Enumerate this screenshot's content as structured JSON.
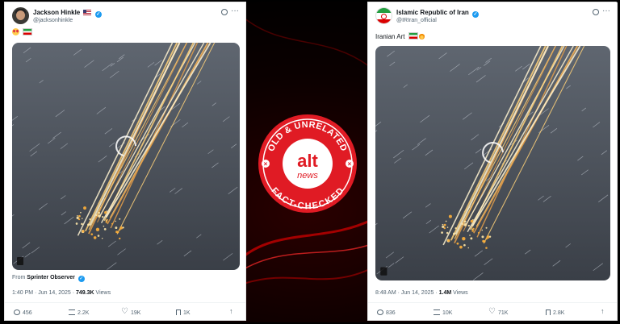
{
  "left_tweet": {
    "name": "Jackson Hinkle",
    "handle": "@jacksonhinkle",
    "from_prefix": "From ",
    "from_source": "Sprinter Observer",
    "time": "1:40 PM · Jun 14, 2025 · ",
    "views_value": "749.3K",
    "views_label": " Views",
    "replies": "456",
    "reposts": "2.2K",
    "likes": "19K",
    "bookmarks": "1K"
  },
  "right_tweet": {
    "name": "Islamic Republic of Iran",
    "handle": "@IRIran_official",
    "text": "Iranian Art ",
    "time": "8:48 AM · Jun 14, 2025 · ",
    "views_value": "1.4M",
    "views_label": " Views",
    "replies": "836",
    "reposts": "10K",
    "likes": "71K",
    "bookmarks": "2.8K"
  },
  "stamp": {
    "top_text": "OLD & UNRELATED",
    "logo_main": "alt",
    "logo_sub": "news",
    "bottom_text": "FACT-CHECKED"
  },
  "colors": {
    "stamp_red": "#e01b24",
    "verified_blue": "#1d9bf0"
  }
}
